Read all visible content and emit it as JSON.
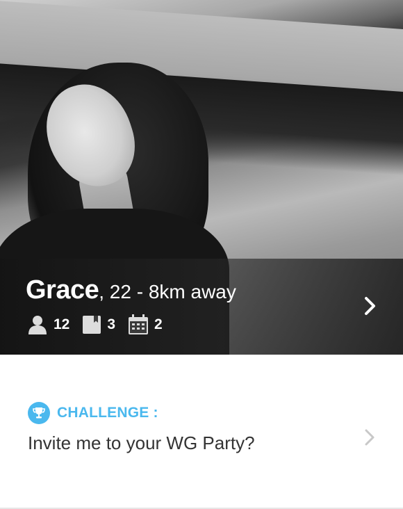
{
  "profile": {
    "name": "Grace",
    "age_distance": ", 22 - 8km away",
    "stats": {
      "friends": "12",
      "books": "3",
      "events": "2"
    }
  },
  "challenge": {
    "label": "CHALLENGE :",
    "text": "Invite me to your WG Party?"
  },
  "colors": {
    "accent": "#4ab8ee",
    "text": "#333333",
    "overlay": "#2a2a2a"
  },
  "icons": [
    "user-icon",
    "book-icon",
    "calendar-icon",
    "chevron-right-icon",
    "trophy-icon"
  ]
}
